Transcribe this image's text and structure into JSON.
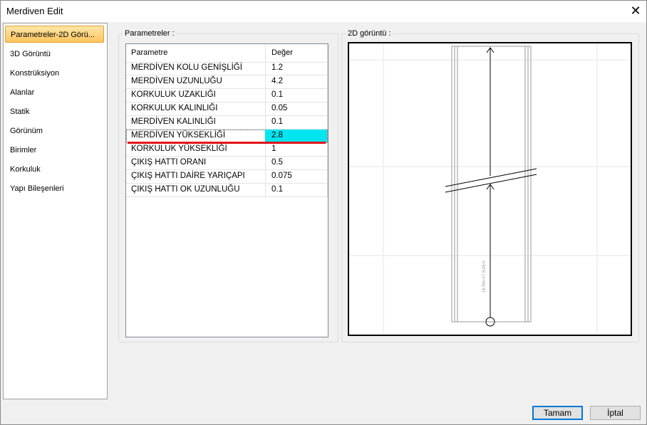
{
  "window": {
    "title": "Merdiven Edit",
    "close_glyph": "✕"
  },
  "sidebar": {
    "items": [
      {
        "label": "Parametreler-2D Görü..."
      },
      {
        "label": "3D Görüntü"
      },
      {
        "label": "Konstrüksiyon"
      },
      {
        "label": "Alanlar"
      },
      {
        "label": "Statik"
      },
      {
        "label": "Görünüm"
      },
      {
        "label": "Birimler"
      },
      {
        "label": "Korkuluk"
      },
      {
        "label": "Yapı Bileşenleri"
      }
    ],
    "active_index": 0
  },
  "params": {
    "group_label": "Parametreler :",
    "columns": [
      "Parametre",
      "Değer"
    ],
    "rows": [
      {
        "name": "MERDİVEN KOLU GENİŞLİĞİ",
        "value": "1.2"
      },
      {
        "name": "MERDİVEN UZUNLUĞU",
        "value": "4.2"
      },
      {
        "name": "KORKULUK UZAKLIĞI",
        "value": "0.1"
      },
      {
        "name": "KORKULUK KALINLIĞI",
        "value": "0.05"
      },
      {
        "name": "MERDİVEN KALINLIĞI",
        "value": "0.1"
      },
      {
        "name": "MERDİVEN YÜKSEKLİĞİ",
        "value": "2.8"
      },
      {
        "name": "KORKULUK YÜKSEKLİĞİ",
        "value": "1"
      },
      {
        "name": "ÇIKIŞ HATTI ORANI",
        "value": "0.5"
      },
      {
        "name": "ÇIKIŞ HATTI DAİRE YARIÇAPI",
        "value": "0.075"
      },
      {
        "name": "ÇIKIŞ HATTI OK UZUNLUĞU",
        "value": "0.1"
      }
    ],
    "selected_index": 5,
    "selection_color": "#00e5f0",
    "error_underline_color": "#e4141c"
  },
  "preview": {
    "group_label": "2D görüntü :",
    "stair_annotation": "16 Rh=17.5/26.0"
  },
  "buttons": {
    "ok": "Tamam",
    "cancel": "İptal"
  }
}
